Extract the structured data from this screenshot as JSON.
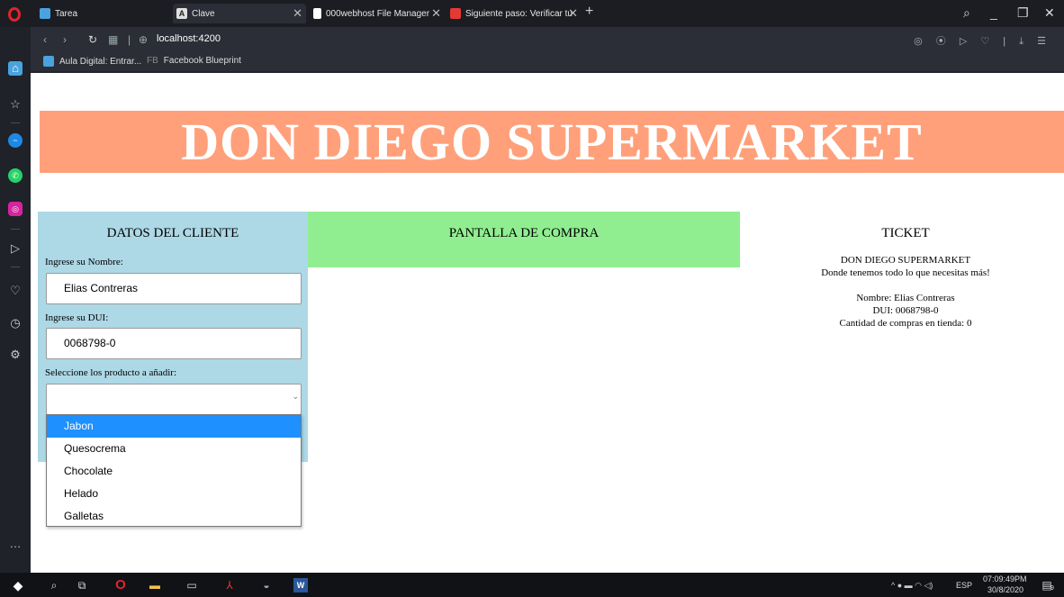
{
  "tabs": [
    {
      "title": "Tarea",
      "active": false,
      "icon": "classroom-icon",
      "color": "#4aa3df"
    },
    {
      "title": "Clave",
      "active": true,
      "icon": "angular-icon",
      "color": "#e0e0e0"
    },
    {
      "title": "000webhost File Manager",
      "active": false,
      "icon": "file-manager-icon",
      "color": "#ffffff"
    },
    {
      "title": "Siguiente paso: Verificar tu",
      "active": false,
      "icon": "mail-icon",
      "color": "#e53935"
    }
  ],
  "address": {
    "url": "localhost:4200"
  },
  "bookmarks": [
    {
      "label": "Aula Digital: Entrar...",
      "icon": "aula-icon"
    },
    {
      "label": "Facebook Blueprint",
      "prefix": "FB",
      "icon": "fb-icon"
    }
  ],
  "page": {
    "banner_title": "DON DIEGO SUPERMARKET",
    "banner_color": "#ffa07a",
    "cliente": {
      "title": "DATOS DEL CLIENTE",
      "nombre_label": "Ingrese su Nombre:",
      "nombre_value": "Elias Contreras",
      "dui_label": "Ingrese su DUI:",
      "dui_value": "0068798-0",
      "producto_label": "Seleccione los producto a añadir:",
      "color": "#add8e6"
    },
    "compra": {
      "title": "PANTALLA DE COMPRA",
      "color": "#90ee90"
    },
    "ticket": {
      "title": "TICKET",
      "store": "DON DIEGO SUPERMARKET",
      "slogan": "Donde tenemos todo lo que necesitas más!",
      "nombre": "Nombre: Elias Contreras",
      "dui": "DUI: 0068798-0",
      "compras": "Cantidad de compras en tienda: 0"
    },
    "dropdown": {
      "options": [
        "Jabon",
        "Quesocrema",
        "Chocolate",
        "Helado",
        "Galletas"
      ],
      "highlighted": "Jabon"
    }
  },
  "taskbar": {
    "language": "ESP",
    "time": "07:09:49PM",
    "date": "30/8/2020",
    "notifications": "9"
  }
}
